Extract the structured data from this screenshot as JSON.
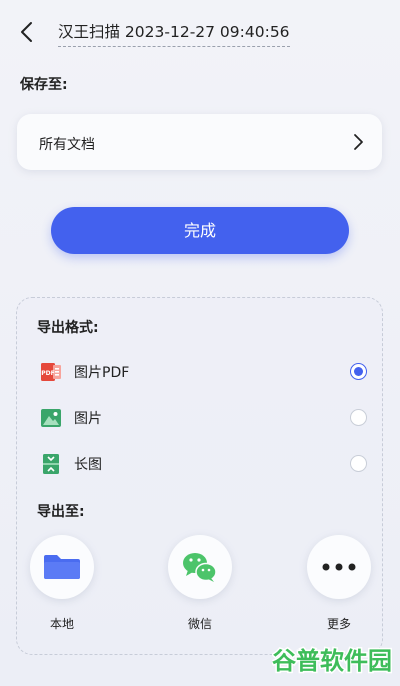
{
  "header": {
    "title": "汉王扫描 2023-12-27 09:40:56"
  },
  "save": {
    "label": "保存至:",
    "location": "所有文档"
  },
  "done_button": "完成",
  "export_format": {
    "title": "导出格式:",
    "options": [
      {
        "label": "图片PDF",
        "icon": "pdf-icon",
        "selected": true
      },
      {
        "label": "图片",
        "icon": "image-icon",
        "selected": false
      },
      {
        "label": "长图",
        "icon": "long-image-icon",
        "selected": false
      }
    ]
  },
  "export_to": {
    "title": "导出至:",
    "targets": [
      {
        "label": "本地",
        "icon": "folder-icon"
      },
      {
        "label": "微信",
        "icon": "wechat-icon"
      },
      {
        "label": "更多",
        "icon": "more-icon"
      }
    ]
  },
  "watermark": "谷普软件园",
  "colors": {
    "accent": "#4361ee",
    "pdf_red": "#e5483b",
    "image_green": "#3aa56a",
    "wechat_green": "#4cc46a",
    "folder_blue": "#4a6cf0"
  }
}
